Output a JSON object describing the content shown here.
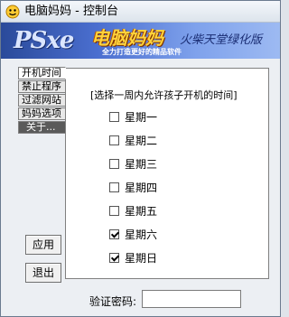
{
  "window": {
    "title": "电脑妈妈 - 控制台"
  },
  "banner": {
    "logo_text": "PSxe",
    "title": "电脑妈妈",
    "subtitle": "火柴天堂绿化版",
    "slogan": "全力打造更好的精品软件"
  },
  "tabs": [
    {
      "label": "开机时间"
    },
    {
      "label": "禁止程序"
    },
    {
      "label": "过滤网站"
    },
    {
      "label": "妈妈选项"
    },
    {
      "label": "关于..."
    }
  ],
  "schedule": {
    "prompt": "[选择一周内允许孩子开机的时间]",
    "days": [
      {
        "label": "星期一",
        "checked": false
      },
      {
        "label": "星期二",
        "checked": false
      },
      {
        "label": "星期三",
        "checked": false
      },
      {
        "label": "星期四",
        "checked": false
      },
      {
        "label": "星期五",
        "checked": false
      },
      {
        "label": "星期六",
        "checked": true
      },
      {
        "label": "星期日",
        "checked": true
      }
    ]
  },
  "buttons": {
    "apply": "应用",
    "exit": "退出"
  },
  "password": {
    "label": "验证密码:",
    "value": ""
  },
  "colors": {
    "banner_gold": "#ffd23a",
    "banner_blue": "#2a4a9a"
  }
}
